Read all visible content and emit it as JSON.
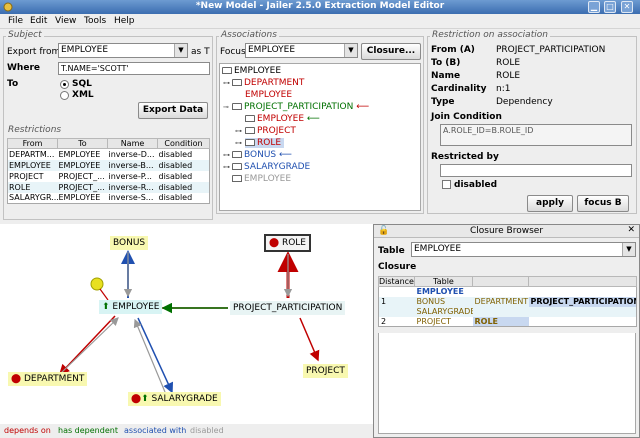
{
  "window": {
    "title": "*New Model - Jailer 2.5.0 Extraction Model Editor"
  },
  "menu": [
    "File",
    "Edit",
    "View",
    "Tools",
    "Help"
  ],
  "subject": {
    "title": "Subject",
    "export_from_label": "Export from",
    "export_from_value": "EMPLOYEE",
    "as_t_label": "as T",
    "where_label": "Where",
    "where_value": "T.NAME='SCOTT'",
    "to_label": "To",
    "sql_label": "SQL",
    "xml_label": "XML",
    "export_button": "Export Data"
  },
  "restrictions": {
    "title": "Restrictions",
    "columns": [
      "From",
      "To",
      "Name",
      "Condition"
    ],
    "rows": [
      [
        "DEPARTM...",
        "EMPLOYEE",
        "inverse-D...",
        "disabled"
      ],
      [
        "EMPLOYEE",
        "EMPLOYEE",
        "inverse-B...",
        "disabled"
      ],
      [
        "PROJECT",
        "PROJECT_...",
        "inverse-P...",
        "disabled"
      ],
      [
        "ROLE",
        "PROJECT_...",
        "inverse-R...",
        "disabled"
      ],
      [
        "SALARYGR...",
        "EMPLOYEE",
        "inverse-S...",
        "disabled"
      ]
    ]
  },
  "associations": {
    "title": "Associations",
    "focus_label": "Focus",
    "focus_value": "EMPLOYEE",
    "closure_button": "Closure...",
    "tree": {
      "root": "EMPLOYEE",
      "department": "DEPARTMENT",
      "department_employee": "EMPLOYEE",
      "project_participation": "PROJECT_PARTICIPATION",
      "pp_employee": "EMPLOYEE",
      "pp_project": "PROJECT",
      "pp_role": "ROLE",
      "bonus": "BONUS",
      "salarygrade": "SALARYGRADE",
      "employee_disabled": "EMPLOYEE"
    }
  },
  "restriction_on_association": {
    "title": "Restriction on association",
    "from_label": "From (A)",
    "from_value": "PROJECT_PARTICIPATION",
    "to_label": "To (B)",
    "to_value": "ROLE",
    "name_label": "Name",
    "name_value": "ROLE",
    "cardinality_label": "Cardinality",
    "cardinality_value": "n:1",
    "type_label": "Type",
    "type_value": "Dependency",
    "join_label": "Join Condition",
    "join_value": "A.ROLE_ID=B.ROLE_ID",
    "restricted_label": "Restricted by",
    "disabled_label": "disabled",
    "apply_button": "apply",
    "focus_b_button": "focus B"
  },
  "graph": {
    "employee": "EMPLOYEE",
    "bonus": "BONUS",
    "role": "ROLE",
    "project_participation": "PROJECT_PARTICIPATION",
    "department": "DEPARTMENT",
    "salarygrade": "SALARYGRADE",
    "project": "PROJECT"
  },
  "legend": {
    "depends_on": "depends on",
    "has_dependent": "has dependent",
    "associated_with": "associated with",
    "disabled": "disabled"
  },
  "closure_browser": {
    "title": "Closure Browser",
    "table_label": "Table",
    "table_value": "EMPLOYEE",
    "closure_label": "Closure",
    "columns": [
      "Distance",
      "Table",
      "",
      ""
    ],
    "rows": [
      {
        "distance": "",
        "c1": "EMPLOYEE",
        "c2": "",
        "c3": ""
      },
      {
        "distance": "1",
        "c1": "BONUS",
        "c2": "DEPARTMENT",
        "c3": "PROJECT_PARTICIPATION"
      },
      {
        "distance": "",
        "c1": "SALARYGRADE",
        "c2": "",
        "c3": ""
      },
      {
        "distance": "2",
        "c1": "PROJECT",
        "c2": "ROLE",
        "c3": ""
      }
    ]
  },
  "colors": {
    "depends_on": "#c00000",
    "has_dependent": "#007000",
    "associated_with": "#2050b0",
    "disabled": "#999999",
    "title_bar": "#3b6db0"
  }
}
